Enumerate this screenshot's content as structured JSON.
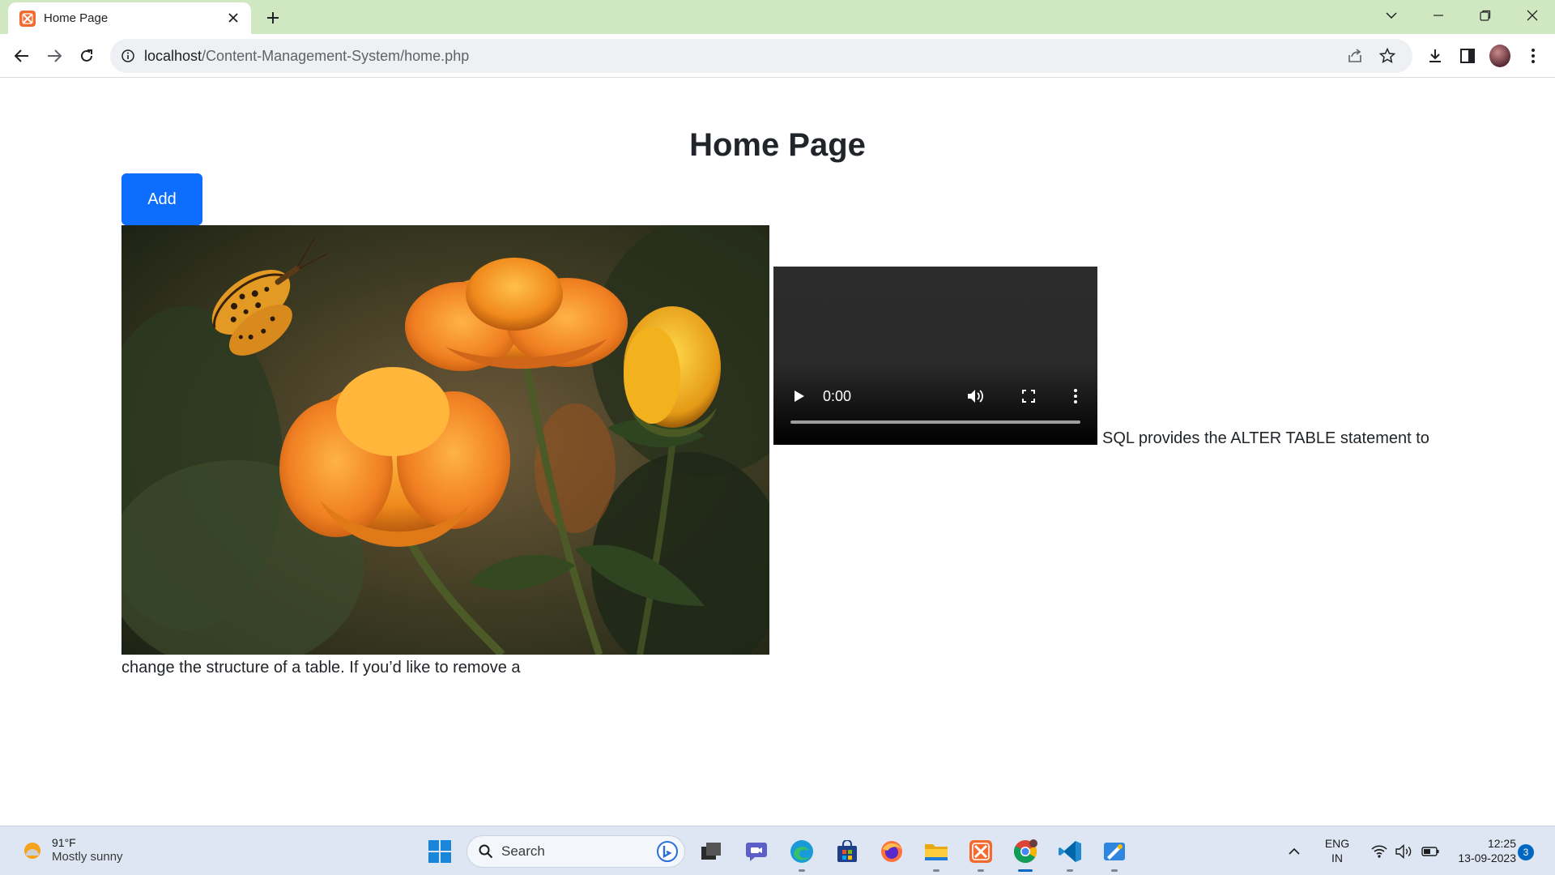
{
  "browser": {
    "tab_title": "Home Page",
    "url_host": "localhost",
    "url_path": "/Content-Management-System/home.php"
  },
  "page": {
    "title": "Home Page",
    "add_button": "Add",
    "video": {
      "time": "0:00"
    },
    "post_text_line1": "SQL provides the ALTER TABLE statement to",
    "post_text_line2": "change the structure of a table. If you’d like to remove a"
  },
  "taskbar": {
    "weather_temp": "91°F",
    "weather_condition": "Mostly sunny",
    "search_label": "Search",
    "language_line1": "ENG",
    "language_line2": "IN",
    "time": "12:25",
    "date": "13-09-2023",
    "notification_count": "3"
  },
  "colors": {
    "tabstrip": "#cfe8c2",
    "add_button": "#0d6efd",
    "taskbar": "#dde6f2",
    "accent": "#0067c0"
  },
  "icons": [
    "xampp-icon",
    "close-icon",
    "plus-icon",
    "chevron-down-icon",
    "minimize-icon",
    "restore-icon",
    "back-icon",
    "forward-icon",
    "reload-icon",
    "info-icon",
    "share-icon",
    "star-icon",
    "download-icon",
    "sidepanel-icon",
    "avatar",
    "kebab-menu-icon",
    "play-icon",
    "volume-icon",
    "fullscreen-icon",
    "weather-sun-icon",
    "windows-start-icon",
    "search-icon",
    "bing-icon",
    "task-view-icon",
    "teams-chat-icon",
    "edge-icon",
    "store-icon",
    "firefox-icon",
    "file-explorer-icon",
    "chrome-icon",
    "vscode-icon",
    "paint-icon",
    "wifi-icon",
    "speaker-icon",
    "battery-icon"
  ]
}
